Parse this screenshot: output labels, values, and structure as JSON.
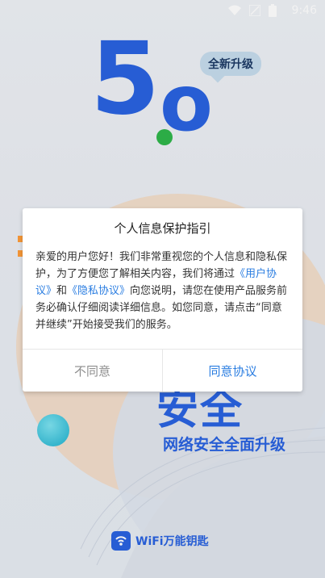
{
  "status_bar": {
    "time": "9:46",
    "icons": [
      "wifi-icon",
      "signal-icon",
      "battery-icon"
    ]
  },
  "logo": {
    "five": "5",
    "zero": "o",
    "badge": "全新升级"
  },
  "background": {
    "slogan": "安全",
    "subtitle": "网络安全全面升级"
  },
  "dialog": {
    "title": "个人信息保护指引",
    "body_1": "亲爱的用户您好！我们非常重视您的个人信息和隐私保护，为了方便您了解相关内容，我们将通过",
    "user_agreement_link": "《用户协议》",
    "and": "和",
    "privacy_link": "《隐私协议》",
    "body_2": "向您说明，请您在使用产品服务前务必确认仔细阅读详细信息。如您同意，请点击“同意并继续”开始接受我们的服务。",
    "disagree_label": "不同意",
    "agree_label": "同意协议"
  },
  "brand": {
    "name": "WiFi万能钥匙"
  },
  "colors": {
    "primary": "#2a63e0",
    "link": "#2a7de1",
    "green_dot": "#2fb64a",
    "orange_accent": "#ff9d3a"
  }
}
